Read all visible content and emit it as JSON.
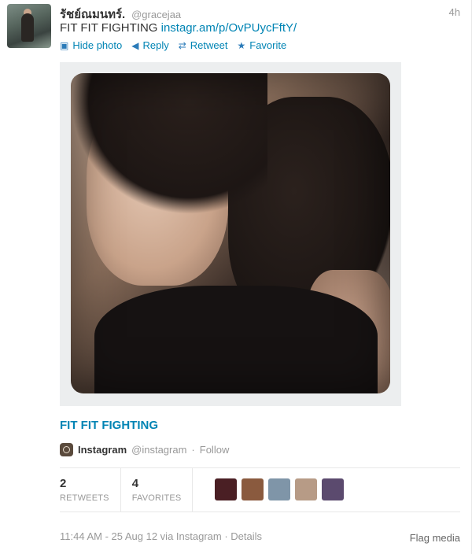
{
  "tweet": {
    "name": "รัชย์ณมนทร์.",
    "handle": "@gracejaa",
    "time": "4h",
    "text": "FIT FIT FIGHTING ",
    "link": "instagr.am/p/OvPUycFftY/"
  },
  "actions": [
    {
      "icon": "photo-icon",
      "label": "Hide photo"
    },
    {
      "icon": "reply-icon",
      "label": "Reply"
    },
    {
      "icon": "retweet-icon",
      "label": "Retweet"
    },
    {
      "icon": "star-icon",
      "label": "Favorite"
    }
  ],
  "media": {
    "caption_title": "FIT FIT FIGHTING",
    "source_name": "Instagram",
    "source_handle": "@instagram",
    "follow_label": "Follow"
  },
  "stats": {
    "retweets_count": "2",
    "retweets_label": "RETWEETS",
    "favorites_count": "4",
    "favorites_label": "FAVORITES"
  },
  "favoriters": [
    "#4a1f24",
    "#8a5a3e",
    "#7f95a8",
    "#b79b86",
    "#5b4a6e"
  ],
  "footer": {
    "details": "11:44 AM - 25 Aug 12 via Instagram · Details",
    "flag": "Flag media"
  },
  "colors": {
    "link": "#0084b4",
    "muted": "#999999"
  }
}
